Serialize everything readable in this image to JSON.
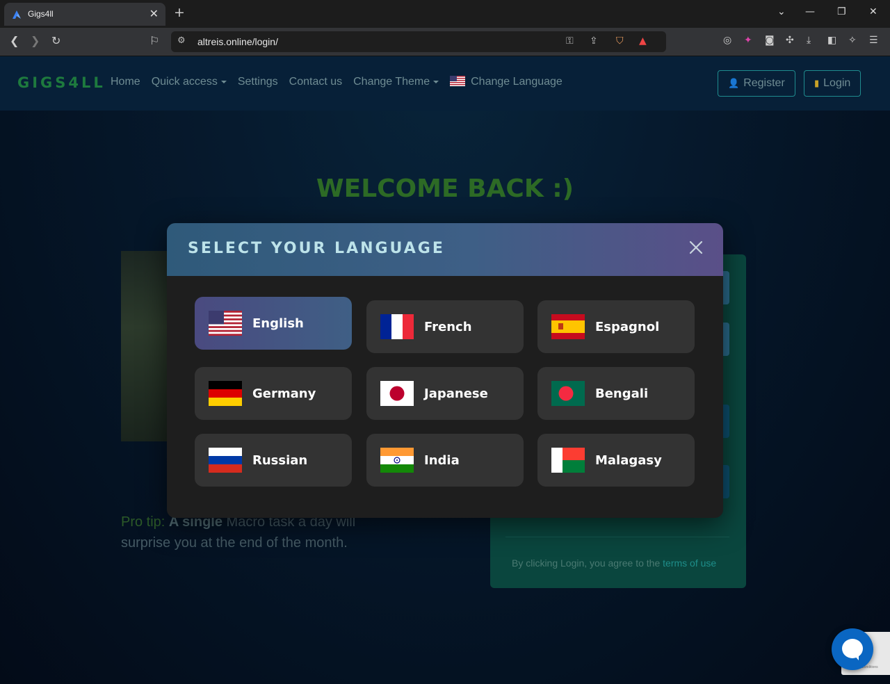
{
  "browser": {
    "tab_title": "Gigs4ll",
    "tab_close": "✕",
    "new_tab": "+",
    "url": "altreis.online/login/",
    "window_controls": [
      "⌄",
      "—",
      "❐",
      "✕"
    ]
  },
  "navbar": {
    "brand": "GIGS4LL",
    "links": [
      {
        "label": "Home",
        "dropdown": false
      },
      {
        "label": "Quick access",
        "dropdown": true
      },
      {
        "label": "Settings",
        "dropdown": false
      },
      {
        "label": "Contact us",
        "dropdown": false
      },
      {
        "label": "Change Theme",
        "dropdown": true
      },
      {
        "label": "Change Language",
        "dropdown": false,
        "icon": "us-flag-icon"
      }
    ],
    "register_label": "Register",
    "login_label": "Login"
  },
  "main": {
    "welcome": "WELCOME BACK :)",
    "protip_lead": "Pro tip:",
    "protip_bold": "A single",
    "protip_rest": " Macro task a day will surprise you at the end of the month.",
    "terms_text": "By clicking Login, you agree to the ",
    "terms_link": "terms of use"
  },
  "modal": {
    "title": "SELECT YOUR LANGUAGE",
    "close_icon": "close-icon",
    "languages": [
      {
        "label": "English",
        "flag": "us",
        "selected": true
      },
      {
        "label": "French",
        "flag": "fr",
        "selected": false
      },
      {
        "label": "Espagnol",
        "flag": "es",
        "selected": false
      },
      {
        "label": "Germany",
        "flag": "de",
        "selected": false
      },
      {
        "label": "Japanese",
        "flag": "jp",
        "selected": false
      },
      {
        "label": "Bengali",
        "flag": "bd",
        "selected": false
      },
      {
        "label": "Russian",
        "flag": "ru",
        "selected": false
      },
      {
        "label": "India",
        "flag": "in",
        "selected": false
      },
      {
        "label": "Malagasy",
        "flag": "mg",
        "selected": false
      }
    ]
  },
  "colors": {
    "brand": "#1e7a3e",
    "modal_header_start": "#2f5a7a",
    "modal_header_end": "#5a4f88",
    "card_bg": "#333333",
    "login_card": "#0a463e",
    "accent_teal": "#1f8c8f",
    "chat_button": "#0a66c2"
  }
}
